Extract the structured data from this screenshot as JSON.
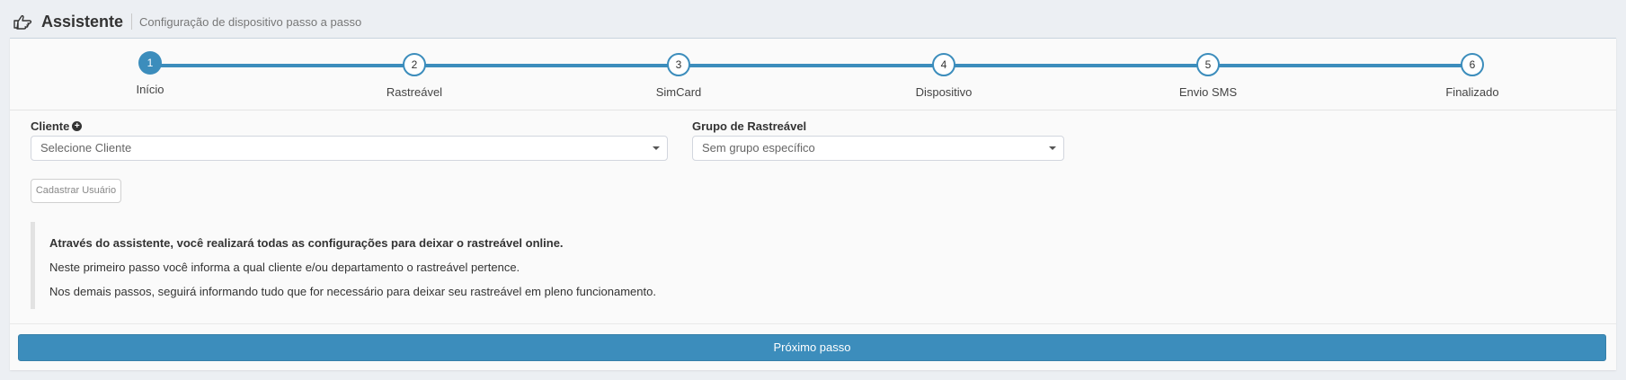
{
  "header": {
    "title": "Assistente",
    "subtitle": "Configuração de dispositivo passo a passo",
    "icon": "hand-pointer-icon"
  },
  "wizard": {
    "steps": [
      {
        "number": "1",
        "label": "Início",
        "active": true
      },
      {
        "number": "2",
        "label": "Rastreável",
        "active": false
      },
      {
        "number": "3",
        "label": "SimCard",
        "active": false
      },
      {
        "number": "4",
        "label": "Dispositivo",
        "active": false
      },
      {
        "number": "5",
        "label": "Envio SMS",
        "active": false
      },
      {
        "number": "6",
        "label": "Finalizado",
        "active": false
      }
    ]
  },
  "form": {
    "client_label": "Cliente",
    "client_placeholder": "Selecione Cliente",
    "group_label": "Grupo de Rastreável",
    "group_value": "Sem grupo específico",
    "register_button": "Cadastrar Usuário"
  },
  "info": {
    "line1": "Através do assistente, você realizará todas as configurações para deixar o rastreável online.",
    "line2": "Neste primeiro passo você informa a qual cliente e/ou departamento o rastreável pertence.",
    "line3": "Nos demais passos, seguirá informando tudo que for necessário para deixar seu rastreável em pleno funcionamento."
  },
  "actions": {
    "next_button": "Próximo passo"
  },
  "colors": {
    "accent": "#3c8dbc",
    "background": "#eceff3"
  }
}
